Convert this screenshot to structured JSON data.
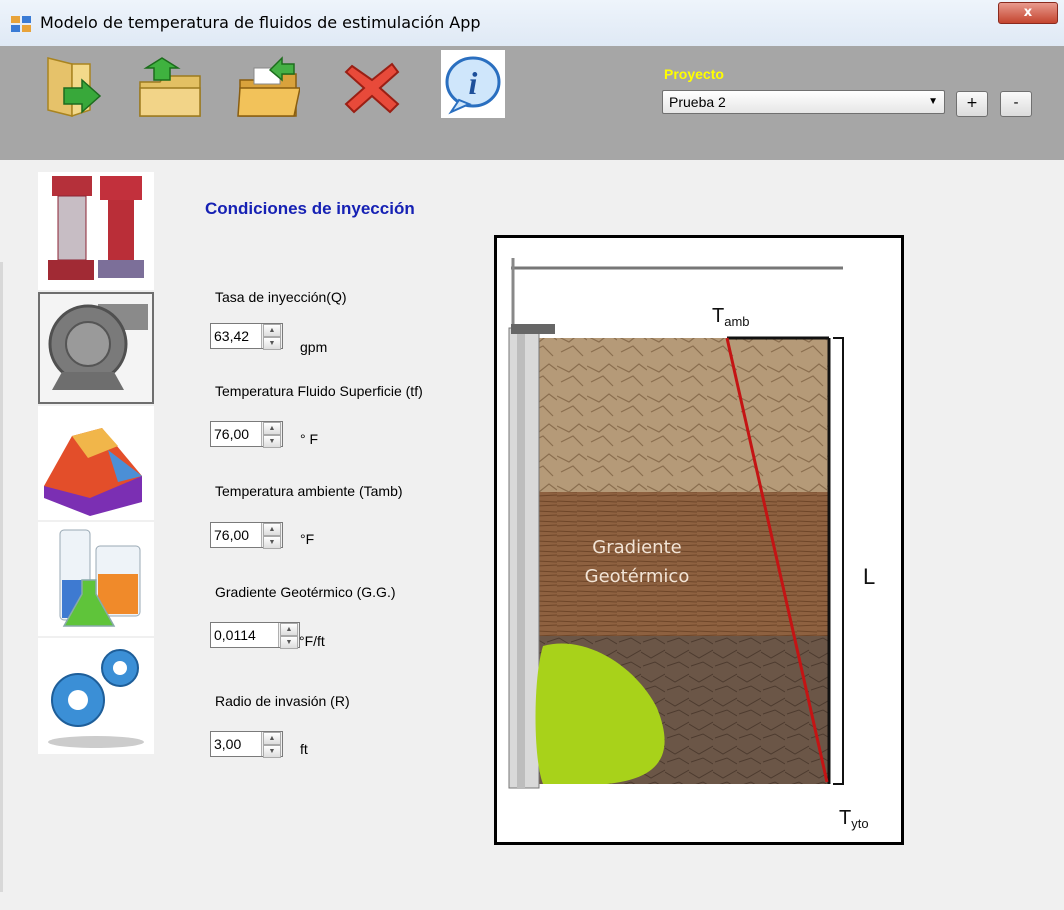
{
  "window": {
    "title": "Modelo de temperatura de fluidos de estimulación App",
    "close_label": "x"
  },
  "toolbar": {
    "icons": [
      "open-folder-icon",
      "upload-folder-icon",
      "save-folder-icon",
      "delete-x-icon",
      "info-icon"
    ],
    "project_label": "Proyecto",
    "project_value": "Prueba 2",
    "add_label": "+",
    "remove_label": "-"
  },
  "sidebar": {
    "items": [
      "pipes-icon",
      "pump-icon",
      "surface-plot-icon",
      "lab-beakers-icon",
      "gears-icon"
    ],
    "selected": "pump-icon"
  },
  "form": {
    "title": "Condiciones de inyección",
    "fields": [
      {
        "label": "Tasa de inyección(Q)",
        "value": "63,42",
        "unit": "gpm"
      },
      {
        "label": "Temperatura Fluido Superficie (tf)",
        "value": "76,00",
        "unit": "° F"
      },
      {
        "label": "Temperatura ambiente (Tamb)",
        "value": "76,00",
        "unit": "°F"
      },
      {
        "label": "Gradiente Geotérmico (G.G.)",
        "value": "0,0114",
        "unit": "°F/ft"
      },
      {
        "label": "Radio de invasión (R)",
        "value": "3,00",
        "unit": "ft"
      }
    ]
  },
  "diagram": {
    "t_amb": "T",
    "t_amb_sub": "amb",
    "t_yto": "T",
    "t_yto_sub": "yto",
    "gradient_line1": "Gradiente",
    "gradient_line2": "Geotérmico",
    "length": "L"
  }
}
